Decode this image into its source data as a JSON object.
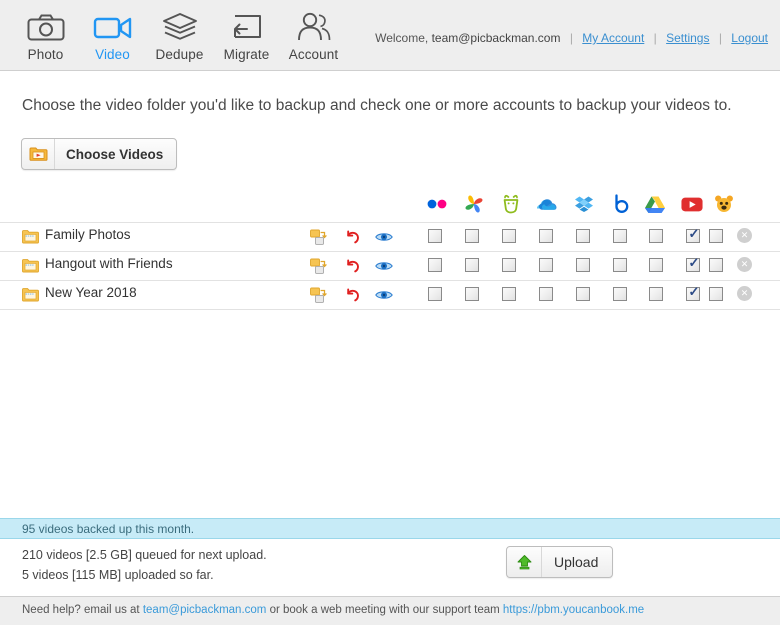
{
  "nav": {
    "items": [
      {
        "label": "Photo",
        "icon": "camera-icon",
        "active": false
      },
      {
        "label": "Video",
        "icon": "video-icon",
        "active": true
      },
      {
        "label": "Dedupe",
        "icon": "layers-icon",
        "active": false
      },
      {
        "label": "Migrate",
        "icon": "migrate-icon",
        "active": false
      },
      {
        "label": "Account",
        "icon": "users-icon",
        "active": false
      }
    ],
    "welcome_label": "Welcome,",
    "user_email": "team@picbackman.com",
    "links": [
      {
        "label": "My Account"
      },
      {
        "label": "Settings"
      },
      {
        "label": "Logout"
      }
    ]
  },
  "main": {
    "headline": "Choose the video folder you'd like to backup and check one or more accounts to backup your videos to.",
    "choose_button": {
      "label": "Choose Videos",
      "icon": "video-folder-icon"
    }
  },
  "services": [
    {
      "name": "flickr",
      "icon": "flickr-icon"
    },
    {
      "name": "google-photos",
      "icon": "google-photos-icon"
    },
    {
      "name": "smugmug",
      "icon": "smugmug-icon"
    },
    {
      "name": "onedrive",
      "icon": "onedrive-icon"
    },
    {
      "name": "dropbox",
      "icon": "dropbox-icon"
    },
    {
      "name": "box",
      "icon": "box-icon"
    },
    {
      "name": "google-drive",
      "icon": "google-drive-icon"
    },
    {
      "name": "youtube",
      "icon": "youtube-icon"
    },
    {
      "name": "photobucket",
      "icon": "photobucket-icon"
    }
  ],
  "folders": [
    {
      "name": "Family Photos",
      "checks": [
        false,
        false,
        false,
        false,
        false,
        false,
        false,
        true,
        false
      ]
    },
    {
      "name": "Hangout with Friends",
      "checks": [
        false,
        false,
        false,
        false,
        false,
        false,
        false,
        true,
        false
      ]
    },
    {
      "name": "New Year 2018",
      "checks": [
        false,
        false,
        false,
        false,
        false,
        false,
        false,
        true,
        false
      ]
    }
  ],
  "row_actions": [
    {
      "name": "subfolder-icon"
    },
    {
      "name": "reset-icon"
    },
    {
      "name": "preview-icon"
    }
  ],
  "status": {
    "banner": "95 videos backed up this month.",
    "queued": "210 videos [2.5 GB] queued for next upload.",
    "uploaded": "5 videos [115 MB] uploaded so far.",
    "upload_button": {
      "label": "Upload",
      "icon": "upload-arrow-icon"
    }
  },
  "footer": {
    "prefix": "Need help? email us at",
    "email": "team@picbackman.com",
    "middle": "or book a web meeting with our support team",
    "url": "https://pbm.youcanbook.me"
  },
  "colors": {
    "accent": "#2196f3",
    "banner_bg": "#c7ebf7",
    "link": "#3a9ad9",
    "nav_bg": "#eeeeee"
  }
}
